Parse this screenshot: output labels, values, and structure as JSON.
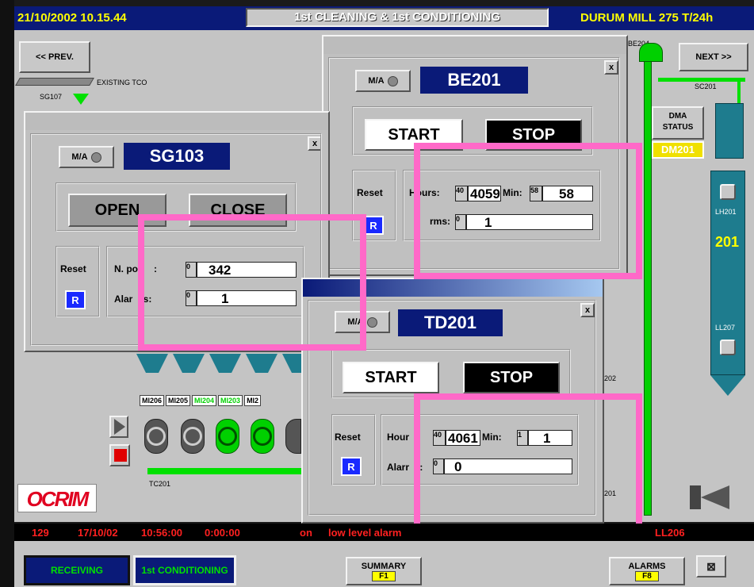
{
  "header": {
    "datetime": "21/10/2002 10.15.44",
    "center_title": "1st CLEANING & 1st CONDITIONING",
    "right_title": "DURUM MILL 275 T/24h"
  },
  "nav": {
    "prev": "<< PREV.",
    "next": "NEXT >>"
  },
  "schematic": {
    "existing_tco": "EXISTING TCO",
    "sg107": "SG107",
    "be204": "BE204",
    "sc201": "SC201",
    "dma_status": "DMA\nSTATUS",
    "dm201": "DM201",
    "lh201": "LH201",
    "silo_number": "201",
    "ll207": "LL207",
    "tc201": "TC201",
    "hoppers": [
      "MI206",
      "MI205",
      "MI204",
      "MI203",
      "MI2"
    ],
    "side_labels": {
      "s202": "202",
      "s201": "201"
    },
    "logo": "OCRIM"
  },
  "dialogs": {
    "sg103": {
      "mode": "M/A",
      "name": "SG103",
      "open_label": "OPEN",
      "close_label": "CLOSE",
      "reset_label": "Reset",
      "reset_btn": "R",
      "npos_label": "N. po      :",
      "npos_small": "0",
      "npos_value": "342",
      "alarms_label": "Alar    s:",
      "alarms_small": "0",
      "alarms_value": "1",
      "close_x": "x"
    },
    "be201": {
      "mode": "M/A",
      "name": "BE201",
      "start_label": "START",
      "stop_label": "STOP",
      "reset_label": "Reset",
      "reset_btn": "R",
      "hours_label": "Hours:",
      "hours_small": "40",
      "hours_value": "4059",
      "min_label": "Min:",
      "min_small": "58",
      "min_value": "58",
      "alarms_label": "rms:",
      "alarms_small": "0",
      "alarms_value": "1",
      "close_x": "x"
    },
    "td201": {
      "mode": "M/A",
      "name": "TD201",
      "start_label": "START",
      "stop_label": "STOP",
      "reset_label": "Reset",
      "reset_btn": "R",
      "hours_label": "Hour",
      "hours_small": "40",
      "hours_value": "4061",
      "min_label": "Min:",
      "min_small": "1",
      "min_value": "1",
      "alarms_label": "Alarr    :",
      "alarms_small": "0",
      "alarms_value": "0",
      "close_x": "x"
    }
  },
  "alarm_bar": {
    "id": "129",
    "date": "17/10/02",
    "time": "10:56:00",
    "duration": "0:00:00",
    "state": "on",
    "message": "low level alarm",
    "tag": "LL206"
  },
  "footer": {
    "receiving": "RECEIVING",
    "conditioning": "1st CONDITIONING",
    "summary": "SUMMARY",
    "summary_key": "F1",
    "alarms": "ALARMS",
    "alarms_key": "F8"
  },
  "colors": {
    "header_bg": "#0a1a78",
    "header_text": "#ffff00",
    "green": "#00e000",
    "teal": "#1e7c8e",
    "alarm_red": "#ff2020",
    "highlight": "#ff69c8"
  }
}
